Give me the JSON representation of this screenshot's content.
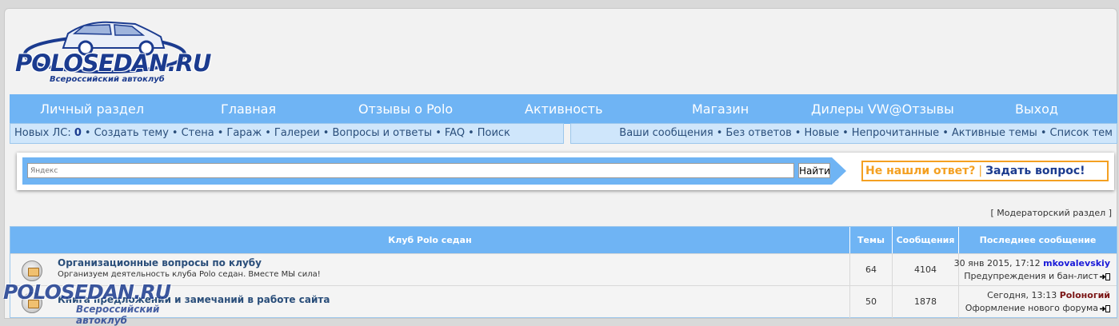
{
  "logo": {
    "title": "POLOSEDAN.RU",
    "subtitle": "Всероссийский автоклуб"
  },
  "mainnav": [
    {
      "label": "Личный раздел"
    },
    {
      "label": "Главная"
    },
    {
      "label": "Отзывы о Polo"
    },
    {
      "label": "Активность"
    },
    {
      "label": "Магазин"
    },
    {
      "label": "Дилеры VW@Отзывы"
    },
    {
      "label": "Выход"
    }
  ],
  "subnav_left": {
    "new_pm_label": "Новых ЛС:",
    "new_pm_count": "0",
    "links": [
      "Создать тему",
      "Стена",
      "Гараж",
      "Галереи",
      "Вопросы и ответы",
      "FAQ",
      "Поиск"
    ]
  },
  "subnav_right": {
    "links": [
      "Ваши сообщения",
      "Без ответов",
      "Новые",
      "Непрочитанные",
      "Активные темы",
      "Список тем"
    ]
  },
  "search": {
    "placeholder": "Яндекс",
    "button_label": "Найти",
    "ask_question": "Не нашли ответ?",
    "ask_separator": "|",
    "ask_link": "Задать вопрос!"
  },
  "moderator": {
    "open": "[",
    "label": "Модераторский раздел",
    "close": "]"
  },
  "forum_table": {
    "headers": {
      "forum": "Клуб Polo седан",
      "topics": "Темы",
      "posts": "Сообщения",
      "last_post": "Последнее сообщение"
    },
    "rows": [
      {
        "title": "Организационные вопросы по клубу",
        "description": "Организуем деятельность клуба Polo седан. Вместе МЫ сила!",
        "topics": "64",
        "posts": "4104",
        "last_date": "30 янв 2015, 17:12",
        "last_user": "mkovalevskiy",
        "last_topic": "Предупреждения и бан-лист"
      },
      {
        "title": "Книга предложений и замечаний в работе сайта",
        "description": "",
        "topics": "50",
        "posts": "1878",
        "last_date": "Сегодня, 13:13",
        "last_user": "Polоногий",
        "last_topic": "Оформление нового форума"
      }
    ]
  },
  "watermark": {
    "title": "POLOSEDAN.RU",
    "subtitle": "Всероссийский автоклуб"
  },
  "colors": {
    "nav_blue": "#6fb4f4",
    "subnav_bg": "#cfe6fb",
    "brand_dark": "#1b3b8f",
    "ask_orange": "#f4a021",
    "user_blue": "#1a1ad8",
    "user_dark_red": "#7a1414"
  }
}
